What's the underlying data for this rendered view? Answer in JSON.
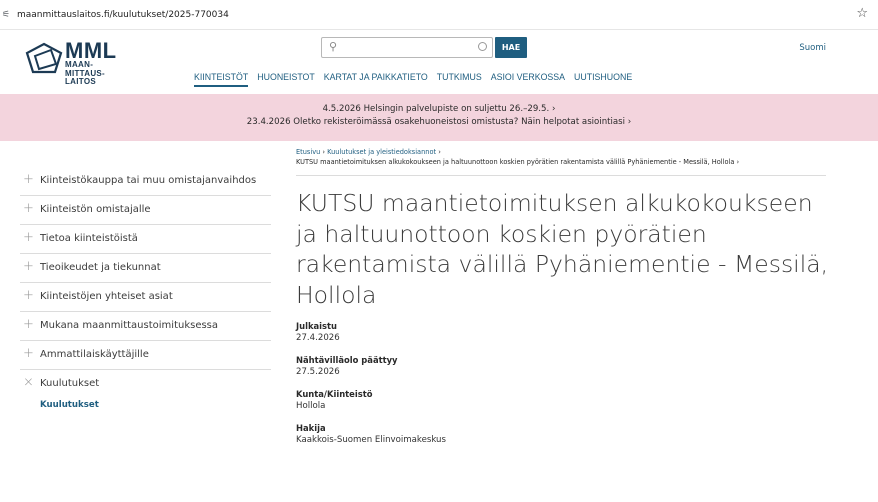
{
  "browser": {
    "url": "maanmittauslaitos.fi/kuulutukset/2025-770034",
    "site_info_icon": "tune-icon",
    "bookmark_icon": "star-icon"
  },
  "header": {
    "logo_main": "MML",
    "logo_sub_lines": [
      "MAAN-",
      "MITTAUS-",
      "LAITOS"
    ],
    "search_placeholder": "",
    "search_button": "HAE",
    "language": "Suomi",
    "nav": [
      {
        "label": "KIINTEISTÖT",
        "active": true
      },
      {
        "label": "HUONEISTOT",
        "active": false
      },
      {
        "label": "KARTAT JA PAIKKATIETO",
        "active": false
      },
      {
        "label": "TUTKIMUS",
        "active": false
      },
      {
        "label": "ASIOI VERKOSSA",
        "active": false
      },
      {
        "label": "UUTISHUONE",
        "active": false
      }
    ]
  },
  "notices": [
    "4.5.2026 Helsingin palvelupiste on suljettu 26.–29.5. ›",
    "23.4.2026 Oletko rekisteröimässä osakehuoneistosi omistusta? Näin helpotat asiointiasi ›"
  ],
  "sidebar": {
    "items": [
      {
        "label": "Kiinteistökauppa tai muu omistajanvaihdos",
        "toggle": "+"
      },
      {
        "label": "Kiinteistön omistajalle",
        "toggle": "+"
      },
      {
        "label": "Tietoa kiinteistöistä",
        "toggle": "+"
      },
      {
        "label": "Tieoikeudet ja tiekunnat",
        "toggle": "+"
      },
      {
        "label": "Kiinteistöjen yhteiset asiat",
        "toggle": "+"
      },
      {
        "label": "Mukana maanmittaustoimituksessa",
        "toggle": "+"
      },
      {
        "label": "Ammattilaiskäyttäjille",
        "toggle": "+"
      },
      {
        "label": "Kuulutukset",
        "toggle": "×"
      }
    ],
    "sub_item": "Kuulutukset"
  },
  "breadcrumb": {
    "home": "Etusivu",
    "parent": "Kuulutukset ja yleistiedoksiannot",
    "current": "KUTSU maantietoimituksen alkukokoukseen ja haltuunottoon koskien pyörätien rakentamista välillä Pyhäniementie - Messilä, Hollola"
  },
  "title": "KUTSU maantietoimituksen alkukokoukseen ja haltuunottoon koskien pyörätien rakentamista välillä Pyhäniementie - Messilä, Hollola",
  "meta": [
    {
      "label": "Julkaistu",
      "value": "27.4.2026"
    },
    {
      "label": "Nähtävilläolo päättyy",
      "value": "27.5.2026"
    },
    {
      "label": "Kunta/Kiinteistö",
      "value": "Hollola"
    },
    {
      "label": "Hakija",
      "value": "Kaakkois-Suomen Elinvoimakeskus"
    }
  ],
  "colors": {
    "brand": "#1f5e80",
    "notice_bg": "#f3d4dd",
    "logo": "#1c3a54"
  }
}
